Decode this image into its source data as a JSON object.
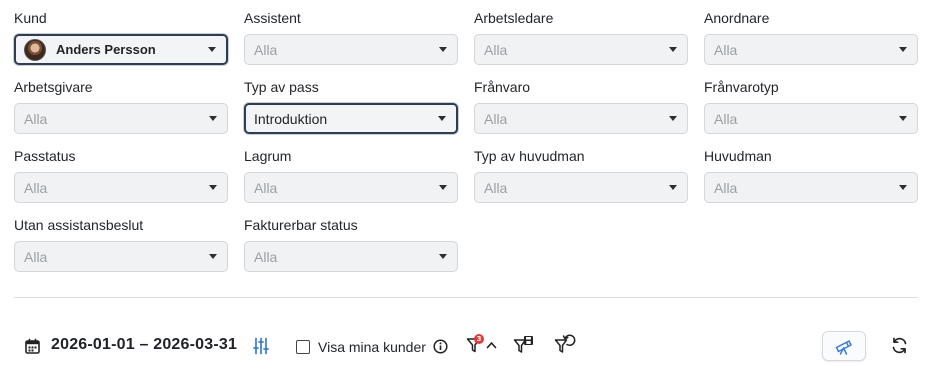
{
  "filters": [
    {
      "label": "Kund",
      "value": "Anders Persson",
      "state": "person"
    },
    {
      "label": "Assistent",
      "value": "Alla",
      "state": "empty"
    },
    {
      "label": "Arbetsledare",
      "value": "Alla",
      "state": "empty"
    },
    {
      "label": "Anordnare",
      "value": "Alla",
      "state": "empty"
    },
    {
      "label": "Arbetsgivare",
      "value": "Alla",
      "state": "empty"
    },
    {
      "label": "Typ av pass",
      "value": "Introduktion",
      "state": "selected"
    },
    {
      "label": "Frånvaro",
      "value": "Alla",
      "state": "empty"
    },
    {
      "label": "Frånvarotyp",
      "value": "Alla",
      "state": "empty"
    },
    {
      "label": "Passtatus",
      "value": "Alla",
      "state": "empty"
    },
    {
      "label": "Lagrum",
      "value": "Alla",
      "state": "empty"
    },
    {
      "label": "Typ av huvudman",
      "value": "Alla",
      "state": "empty"
    },
    {
      "label": "Huvudman",
      "value": "Alla",
      "state": "empty"
    },
    {
      "label": "Utan assistansbeslut",
      "value": "Alla",
      "state": "empty"
    },
    {
      "label": "Fakturerbar status",
      "value": "Alla",
      "state": "empty"
    }
  ],
  "toolbar": {
    "date_range": "2026-01-01 – 2026-03-31",
    "my_customers_label": "Visa mina kunder",
    "my_customers_checked": false,
    "active_filter_count": "3",
    "icons": {
      "calendar": "calendar-icon",
      "adjust": "sliders-icon",
      "info": "info-icon",
      "filter": "filter-icon",
      "collapse": "chevron-up-icon",
      "save_filter": "filter-save-icon",
      "reset_filter": "filter-reset-icon",
      "telescope": "telescope-icon",
      "refresh": "refresh-icon"
    }
  },
  "colors": {
    "focus_border": "#2c3e50",
    "badge": "#e03a3a",
    "accent_icon": "#3a7bd5"
  }
}
